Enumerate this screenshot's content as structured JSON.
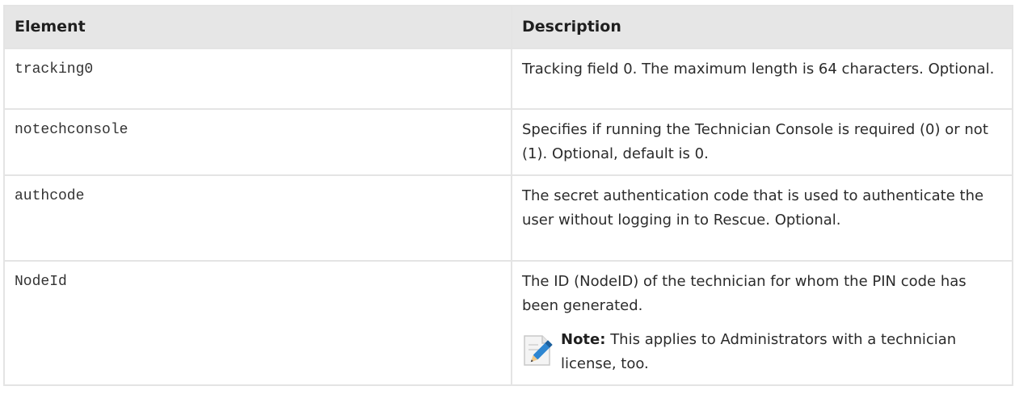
{
  "table": {
    "headers": {
      "element": "Element",
      "description": "Description"
    },
    "rows": [
      {
        "element": "tracking0",
        "description": "Tracking field 0. The maximum length is 64 characters. Optional."
      },
      {
        "element": "notechconsole",
        "description": "Specifies if running the Technician Console is required (0) or not (1). Optional, default is 0."
      },
      {
        "element": "authcode",
        "description": "The secret authentication code that is used to authenticate the user without logging in to Rescue. Optional."
      },
      {
        "element": "NodeId",
        "description": "The ID (NodeID) of the technician for whom the PIN code has been generated.",
        "note": {
          "label": "Note:",
          "text": "This applies to Administrators with a technician license, too.",
          "icon": "note-pencil-icon"
        }
      }
    ]
  }
}
